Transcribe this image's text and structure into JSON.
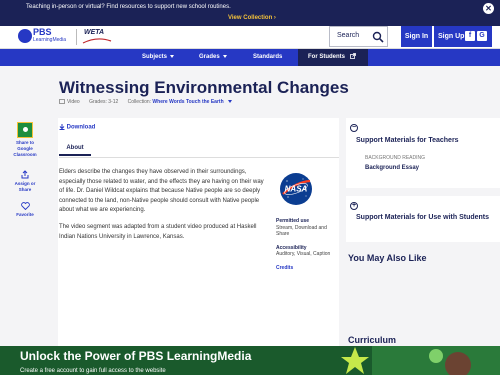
{
  "promo": {
    "text": "Teaching in-person or virtual? Find resources to support new school routines.",
    "link": "View Collection ›",
    "close_icon": "close-icon"
  },
  "header": {
    "logo_main": "PBS",
    "logo_sub": "LearningMedia",
    "partner": "WETA",
    "search_label": "Search",
    "signin": "Sign In",
    "signup": "Sign Up"
  },
  "nav": {
    "subjects": "Subjects",
    "grades": "Grades",
    "standards": "Standards",
    "students": "For Students"
  },
  "page": {
    "title": "Witnessing Environmental Changes",
    "type": "Video",
    "grades": "Grades: 3-12",
    "collection_label": "Collection:",
    "collection_name": "Where Words Touch the Earth"
  },
  "rail": {
    "share_gc": [
      "Share to",
      "Google",
      "Classroom"
    ],
    "assign": [
      "Assign or",
      "Share"
    ],
    "favorite": "Favorite"
  },
  "main": {
    "download": "Download",
    "tab_about": "About",
    "paragraphs": [
      "Elders describe the changes they have observed in their surroundings, especially those related to water, and the effects they are having on their way of life. Dr. Daniel Wildcat explains that because Native people are so deeply connected to the land, non-Native people should consult with Native people about what we are experiencing.",
      "The video segment was adapted from a student video produced at Haskell Indian Nations University in Lawrence, Kansas."
    ],
    "permitted_label": "Permitted use",
    "permitted_value": "Stream, Download and Share",
    "accessibility_label": "Accessibility",
    "accessibility_value": "Auditory, Visual, Caption",
    "credits": "Credits"
  },
  "right": {
    "teachers_title": "Support Materials for Teachers",
    "background_label": "BACKGROUND READING",
    "background_link": "Background Essay",
    "students_title": "Support Materials for Use with Students",
    "also_like": "You May Also Like",
    "curriculum": "Curriculum"
  },
  "banner": {
    "title": "Unlock the Power of PBS LearningMedia",
    "sub": "Create a free account to gain full access to the website"
  },
  "colors": {
    "navy": "#1b2256",
    "blue": "#2638c4",
    "gold": "#f4c23a",
    "banner_green": "#1a5a2c"
  }
}
